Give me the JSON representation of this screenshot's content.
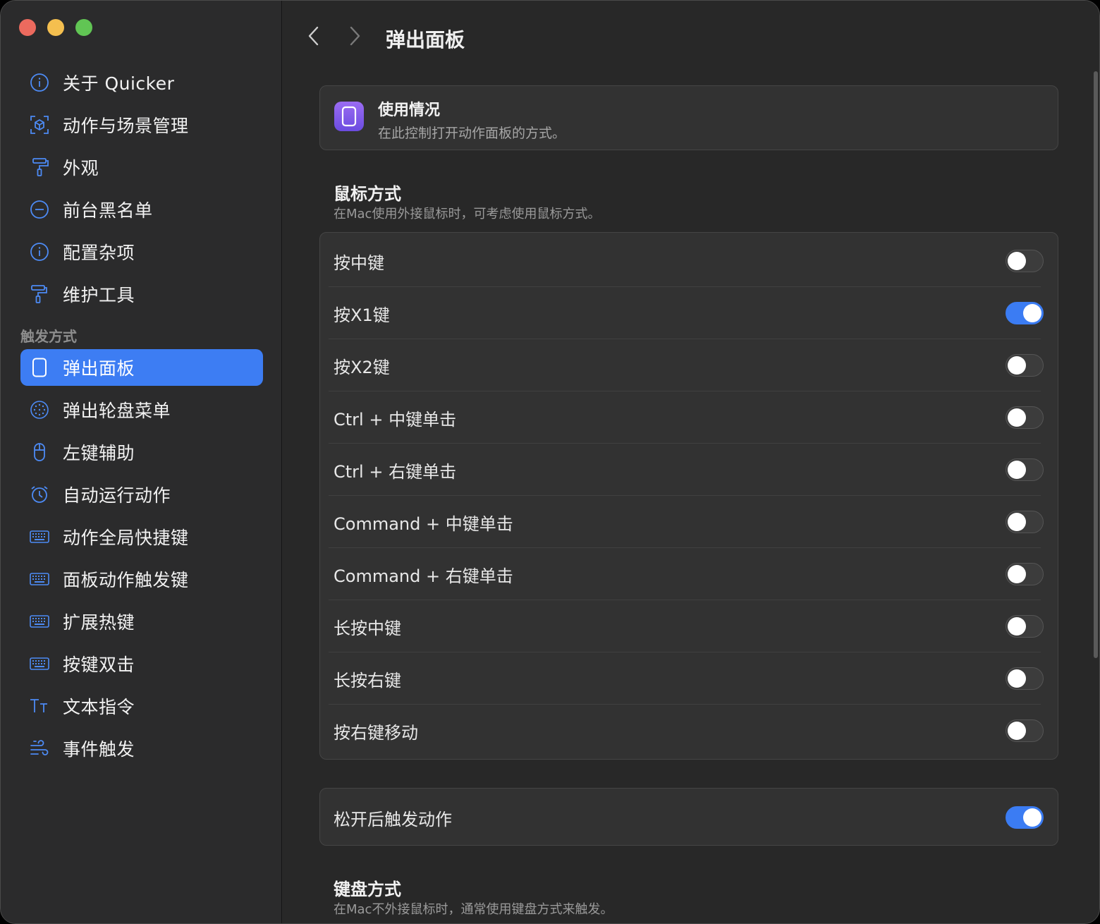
{
  "window": {
    "colors": {
      "accent": "#3d7df3",
      "close": "#ec6a5e",
      "minimize": "#f4bf4f",
      "maximize": "#61c554"
    }
  },
  "sidebar": {
    "items_top": [
      {
        "label": "关于 Quicker",
        "icon": "info-circle-icon"
      },
      {
        "label": "动作与场景管理",
        "icon": "cube-scan-icon"
      },
      {
        "label": "外观",
        "icon": "paint-roller-icon"
      },
      {
        "label": "前台黑名单",
        "icon": "minus-circle-icon"
      },
      {
        "label": "配置杂项",
        "icon": "info-circle-icon"
      },
      {
        "label": "维护工具",
        "icon": "paint-roller-icon"
      }
    ],
    "section_label": "触发方式",
    "items_trigger": [
      {
        "label": "弹出面板",
        "icon": "panel-icon",
        "selected": true
      },
      {
        "label": "弹出轮盘菜单",
        "icon": "dial-icon"
      },
      {
        "label": "左键辅助",
        "icon": "mouse-icon"
      },
      {
        "label": "自动运行动作",
        "icon": "alarm-clock-icon"
      },
      {
        "label": "动作全局快捷键",
        "icon": "keyboard-icon"
      },
      {
        "label": "面板动作触发键",
        "icon": "keyboard-icon"
      },
      {
        "label": "扩展热键",
        "icon": "keyboard-icon"
      },
      {
        "label": "按键双击",
        "icon": "keyboard-icon"
      },
      {
        "label": "文本指令",
        "icon": "text-size-icon"
      },
      {
        "label": "事件触发",
        "icon": "wind-icon"
      }
    ]
  },
  "main": {
    "title": "弹出面板",
    "usage": {
      "title": "使用情况",
      "description": "在此控制打开动作面板的方式。"
    },
    "mouse_section": {
      "title": "鼠标方式",
      "description": "在Mac使用外接鼠标时，可考虑使用鼠标方式。",
      "rows": [
        {
          "label": "按中键",
          "on": false
        },
        {
          "label": "按X1键",
          "on": true
        },
        {
          "label": "按X2键",
          "on": false
        },
        {
          "label": "Ctrl + 中键单击",
          "on": false
        },
        {
          "label": "Ctrl + 右键单击",
          "on": false
        },
        {
          "label": "Command + 中键单击",
          "on": false
        },
        {
          "label": "Command + 右键单击",
          "on": false
        },
        {
          "label": "长按中键",
          "on": false
        },
        {
          "label": "长按右键",
          "on": false
        },
        {
          "label": "按右键移动",
          "on": false
        }
      ]
    },
    "release_row": {
      "label": "松开后触发动作",
      "on": true
    },
    "keyboard_section": {
      "title": "键盘方式",
      "description": "在Mac不外接鼠标时，通常使用键盘方式来触发。"
    }
  }
}
